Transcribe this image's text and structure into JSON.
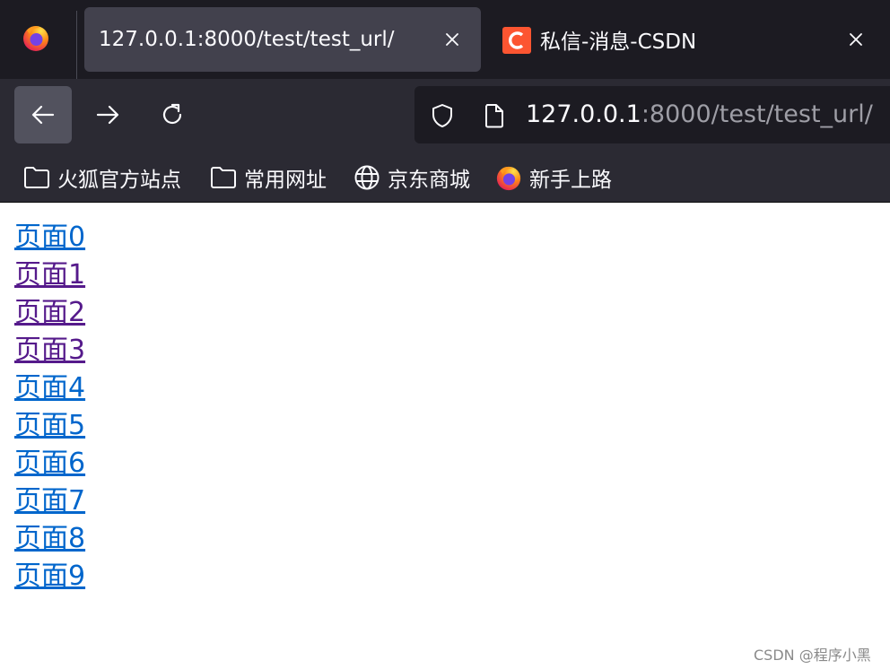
{
  "tabs": [
    {
      "title": "127.0.0.1:8000/test/test_url/",
      "active": true
    },
    {
      "title": "私信-消息-CSDN",
      "active": false,
      "favicon": "csdn-icon"
    }
  ],
  "nav": {
    "url_host": "127.0.0.1",
    "url_rest": ":8000/test/test_url/"
  },
  "bookmarks": [
    {
      "label": "火狐官方站点",
      "icon": "folder-icon"
    },
    {
      "label": "常用网址",
      "icon": "folder-icon"
    },
    {
      "label": "京东商城",
      "icon": "globe-icon"
    },
    {
      "label": "新手上路",
      "icon": "firefox-icon"
    }
  ],
  "links": [
    {
      "label": "页面0",
      "visited": false
    },
    {
      "label": "页面1",
      "visited": true
    },
    {
      "label": "页面2",
      "visited": true
    },
    {
      "label": "页面3",
      "visited": true
    },
    {
      "label": "页面4",
      "visited": false
    },
    {
      "label": "页面5",
      "visited": false
    },
    {
      "label": "页面6",
      "visited": false
    },
    {
      "label": "页面7",
      "visited": false
    },
    {
      "label": "页面8",
      "visited": false
    },
    {
      "label": "页面9",
      "visited": false
    }
  ],
  "colors": {
    "link": "#0066cc",
    "visited": "#551a8b"
  },
  "watermark": "CSDN @程序小黑"
}
